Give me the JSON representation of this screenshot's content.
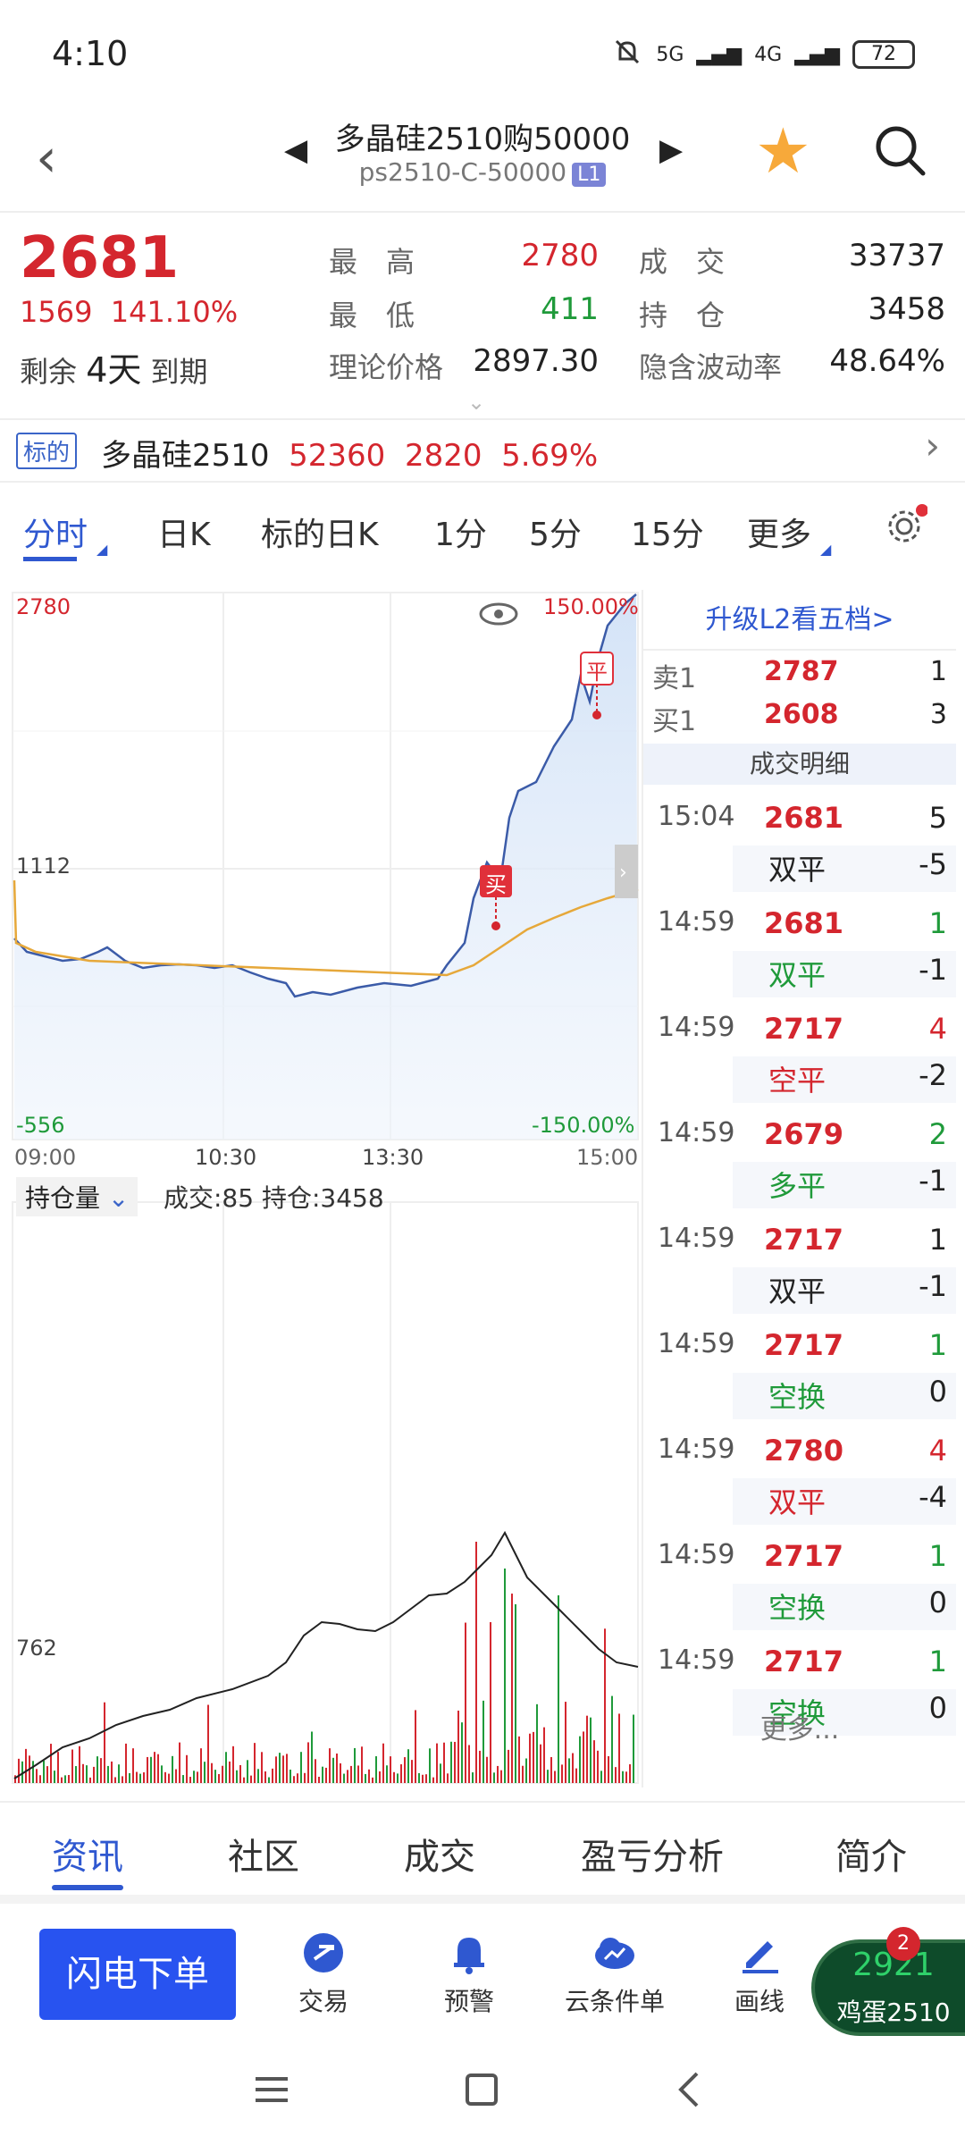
{
  "status_bar": {
    "time": "4:10",
    "net1": "5G",
    "net2": "4G",
    "battery": "72"
  },
  "header": {
    "title": "多晶硅2510购50000",
    "code": "ps2510-C-50000",
    "level_badge": "L1"
  },
  "quote": {
    "last": "2681",
    "change": "1569",
    "change_pct": "141.10%",
    "remaining_label": "剩余",
    "remaining_days": "4天",
    "expire_label": "到期",
    "high_label": "最　高",
    "high": "2780",
    "low_label": "最　低",
    "low": "411",
    "theory_label": "理论价格",
    "theory": "2897.30",
    "volume_label": "成　交",
    "volume": "33737",
    "oi_label": "持　仓",
    "oi": "3458",
    "iv_label": "隐含波动率",
    "iv": "48.64%"
  },
  "underlying": {
    "tag": "标的",
    "name": "多晶硅2510",
    "price": "52360",
    "change": "2820",
    "pct": "5.69%"
  },
  "tabs": [
    "分时",
    "日K",
    "标的日K",
    "1分",
    "5分",
    "15分",
    "更多"
  ],
  "chart": {
    "top_price": "2780",
    "top_pct": "150.00%",
    "mid_price": "1112",
    "bottom_price": "-556",
    "bottom_pct": "-150.00%",
    "times": [
      "09:00",
      "10:30",
      "13:30",
      "15:00"
    ],
    "sub_selector": "持仓量",
    "sub_info": "成交:85 持仓:3458",
    "sub_level": "762",
    "buy_marker": "买",
    "close_marker": "平"
  },
  "book": {
    "upgrade": "升级L2看五档>",
    "levels": [
      {
        "label": "卖1",
        "price": "2787",
        "qty": "1"
      },
      {
        "label": "买1",
        "price": "2608",
        "qty": "3"
      }
    ],
    "detail_title": "成交明细",
    "trades": [
      {
        "time": "15:04",
        "price": "2681",
        "vol": "5",
        "vol_color": "#222",
        "type": "双平",
        "type_color": "#222",
        "oi": "-5"
      },
      {
        "time": "14:59",
        "price": "2681",
        "vol": "1",
        "vol_color": "#1f9a3a",
        "type": "双平",
        "type_color": "#1f9a3a",
        "oi": "-1"
      },
      {
        "time": "14:59",
        "price": "2717",
        "vol": "4",
        "vol_color": "#d4262e",
        "type": "空平",
        "type_color": "#d4262e",
        "oi": "-2"
      },
      {
        "time": "14:59",
        "price": "2679",
        "vol": "2",
        "vol_color": "#1f9a3a",
        "type": "多平",
        "type_color": "#1f9a3a",
        "oi": "-1"
      },
      {
        "time": "14:59",
        "price": "2717",
        "vol": "1",
        "vol_color": "#222",
        "type": "双平",
        "type_color": "#222",
        "oi": "-1"
      },
      {
        "time": "14:59",
        "price": "2717",
        "vol": "1",
        "vol_color": "#1f9a3a",
        "type": "空换",
        "type_color": "#1f9a3a",
        "oi": "0"
      },
      {
        "time": "14:59",
        "price": "2780",
        "vol": "4",
        "vol_color": "#d4262e",
        "type": "双平",
        "type_color": "#d4262e",
        "oi": "-4"
      },
      {
        "time": "14:59",
        "price": "2717",
        "vol": "1",
        "vol_color": "#1f9a3a",
        "type": "空换",
        "type_color": "#1f9a3a",
        "oi": "0"
      },
      {
        "time": "14:59",
        "price": "2717",
        "vol": "1",
        "vol_color": "#1f9a3a",
        "type": "空换",
        "type_color": "#1f9a3a",
        "oi": "0"
      }
    ],
    "more": "更多..."
  },
  "bottom_tabs": [
    "资讯",
    "社区",
    "成交",
    "盈亏分析",
    "简介"
  ],
  "actions": {
    "flash": "闪电下单",
    "items": [
      "交易",
      "预警",
      "云条件单",
      "画线"
    ],
    "egg_price": "2921",
    "egg_name": "鸡蛋2510",
    "egg_badge": "2"
  },
  "colors": {
    "up": "#d4262e",
    "down": "#1f9a3a",
    "accent": "#2f58d0",
    "price_line": "#3b5ba8",
    "avg_line": "#e6a83a"
  }
}
